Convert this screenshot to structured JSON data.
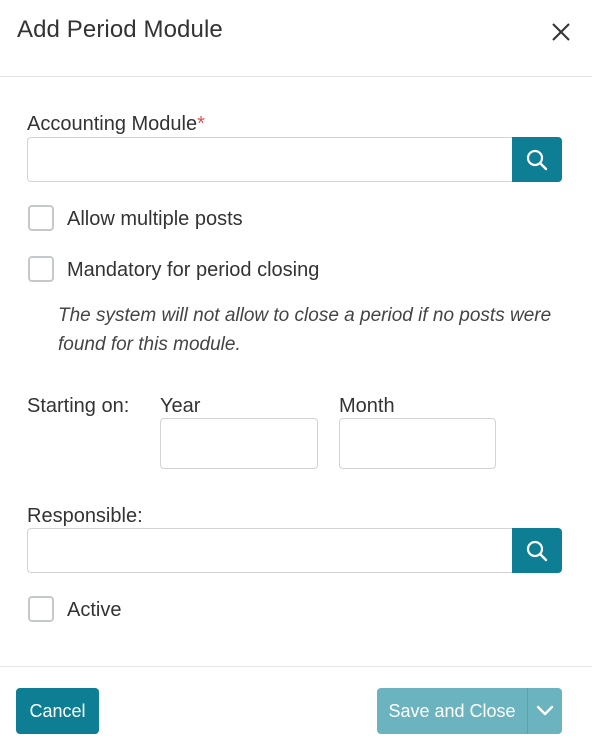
{
  "dialog": {
    "title": "Add Period Module",
    "close_icon": "close-icon"
  },
  "form": {
    "accounting_module": {
      "label": "Accounting Module",
      "required_marker": "*",
      "value": "",
      "search_icon": "search-icon"
    },
    "allow_multiple_posts": {
      "label": "Allow multiple posts",
      "checked": false
    },
    "mandatory_for_closing": {
      "label": "Mandatory for period closing",
      "checked": false,
      "help_text": "The system will not allow to close a period if no posts were found for this module."
    },
    "starting_on": {
      "label": "Starting on:",
      "year_label": "Year",
      "year_value": "",
      "month_label": "Month",
      "month_value": ""
    },
    "responsible": {
      "label": "Responsible:",
      "value": "",
      "search_icon": "search-icon"
    },
    "active": {
      "label": "Active",
      "checked": false
    }
  },
  "footer": {
    "cancel_label": "Cancel",
    "save_label": "Save and Close",
    "save_dropdown_icon": "chevron-down-icon"
  },
  "colors": {
    "primary": "#0d7e93",
    "primary_disabled": "#6bb4bf",
    "required": "#d9534f"
  }
}
